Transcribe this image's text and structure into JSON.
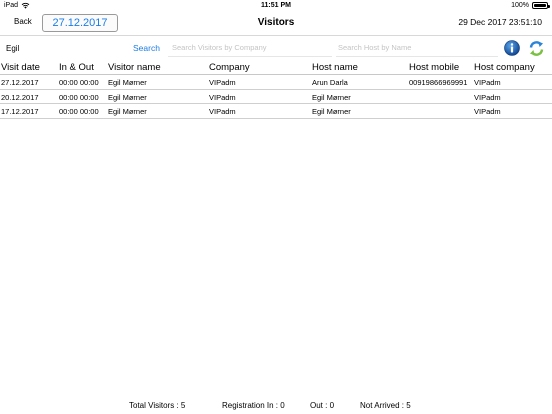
{
  "status_bar": {
    "device": "iPad",
    "time": "11:51 PM",
    "battery_text": "100%",
    "battery_level": 100
  },
  "nav": {
    "back_label": "Back",
    "date_button": "27.12.2017",
    "title": "Visitors",
    "datetime": "29 Dec 2017 23:51:10"
  },
  "search": {
    "visitor_value": "Egil",
    "search_label": "Search",
    "company_placeholder": "Search Visitors by Company",
    "host_placeholder": "Search Host by Name",
    "icons": {
      "info": "info-icon",
      "refresh": "refresh-icon"
    },
    "colors": {
      "accent": "#1a7de6",
      "refresh_green": "#7bc043"
    }
  },
  "table": {
    "headers": [
      "Visit date",
      "In & Out",
      "Visitor name",
      "Company",
      "Host name",
      "Host mobile",
      "Host company"
    ],
    "rows": [
      [
        "27.12.2017",
        "00:00  00:00",
        "Egil Mørner",
        "VIPadm",
        "Arun Darla",
        "00919866969991",
        "VIPadm"
      ],
      [
        "20.12.2017",
        "00:00  00:00",
        "Egil Mørner",
        "VIPadm",
        "Egil Mørner",
        "",
        "VIPadm"
      ],
      [
        "17.12.2017",
        "00:00  00:00",
        "Egil Mørner",
        "VIPadm",
        "Egil Mørner",
        "",
        "VIPadm"
      ]
    ]
  },
  "footer": {
    "total_visitors": "Total Visitors : 5",
    "registration_in": "Registration In : 0",
    "out": "Out : 0",
    "not_arrived": "Not Arrived : 5"
  }
}
